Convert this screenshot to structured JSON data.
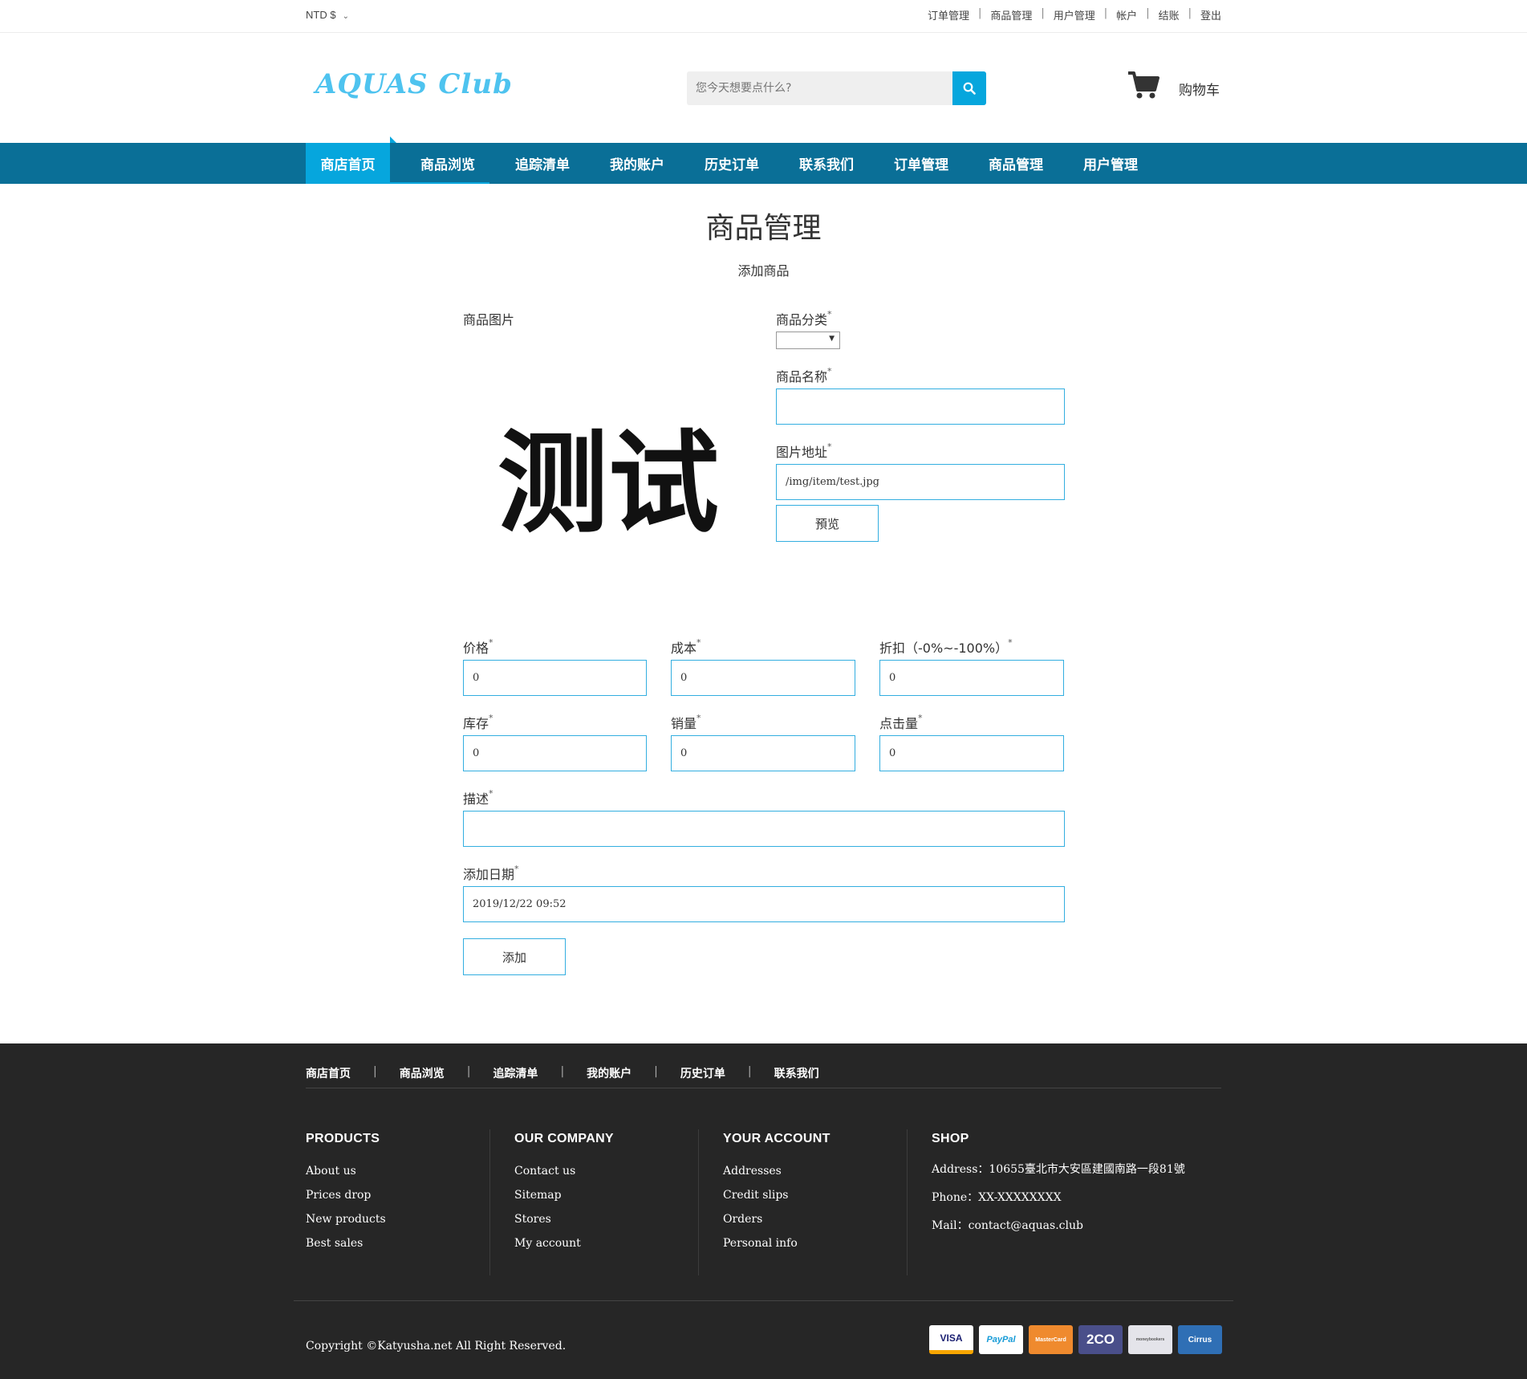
{
  "topbar": {
    "currency": "NTD $",
    "links": [
      "订单管理",
      "商品管理",
      "用户管理",
      "帐户",
      "结账",
      "登出"
    ]
  },
  "header": {
    "logo_text": "AQUAS Club",
    "search_placeholder": "您今天想要点什么?",
    "cart_label": "购物车"
  },
  "nav": {
    "items": [
      "商店首页",
      "商品浏览",
      "追踪清单",
      "我的账户",
      "历史订单",
      "联系我们",
      "订单管理",
      "商品管理",
      "用户管理"
    ],
    "active_index": 0
  },
  "main": {
    "title": "商品管理",
    "subtitle": "添加商品",
    "image_label": "商品图片",
    "image_preview_text": "测试",
    "category_label": "商品分类",
    "category_value": "",
    "name_label": "商品名称",
    "name_value": "",
    "image_url_label": "图片地址",
    "image_url_value": "/img/item/test.jpg",
    "preview_button": "預览",
    "price_label": "价格",
    "price_value": "0",
    "cost_label": "成本",
    "cost_value": "0",
    "discount_label": "折扣（-0%~-100%）",
    "discount_value": "0",
    "stock_label": "库存",
    "stock_value": "0",
    "sales_label": "销量",
    "sales_value": "0",
    "clicks_label": "点击量",
    "clicks_value": "0",
    "desc_label": "描述",
    "desc_value": "",
    "date_label": "添加日期",
    "date_value": "2019/12/22 09:52",
    "add_button": "添加",
    "required_mark": "*"
  },
  "footer": {
    "links": [
      "商店首页",
      "商品浏览",
      "追踪清单",
      "我的账户",
      "历史订单",
      "联系我们"
    ],
    "columns": [
      {
        "heading": "PRODUCTS",
        "items": [
          "About us",
          "Prices drop",
          "New products",
          "Best sales"
        ]
      },
      {
        "heading": "OUR COMPANY",
        "items": [
          "Contact us",
          "Sitemap",
          "Stores",
          "My account"
        ]
      },
      {
        "heading": "YOUR ACCOUNT",
        "items": [
          "Addresses",
          "Credit slips",
          "Orders",
          "Personal info"
        ]
      }
    ],
    "shop": {
      "heading": "SHOP",
      "address": "Address：10655臺北市大安區建國南路一段81號",
      "phone": "Phone：XX-XXXXXXXX",
      "mail": "Mail：contact@aquas.club"
    },
    "copyright": "Copyright ©Katyusha.net All Right Reserved.",
    "payments": [
      {
        "label": "VISA",
        "icon": "visa-icon"
      },
      {
        "label": "PayPal",
        "icon": "paypal-icon"
      },
      {
        "label": "MasterCard",
        "icon": "mastercard-icon"
      },
      {
        "label": "2CO",
        "icon": "2co-icon"
      },
      {
        "label": "moneybookers",
        "icon": "moneybookers-icon"
      },
      {
        "label": "Cirrus",
        "icon": "cirrus-icon"
      }
    ]
  },
  "colors": {
    "accent": "#06a6dd",
    "nav_bg": "#0a6f97",
    "footer_bg": "#262626",
    "field_border": "#33aee0"
  }
}
